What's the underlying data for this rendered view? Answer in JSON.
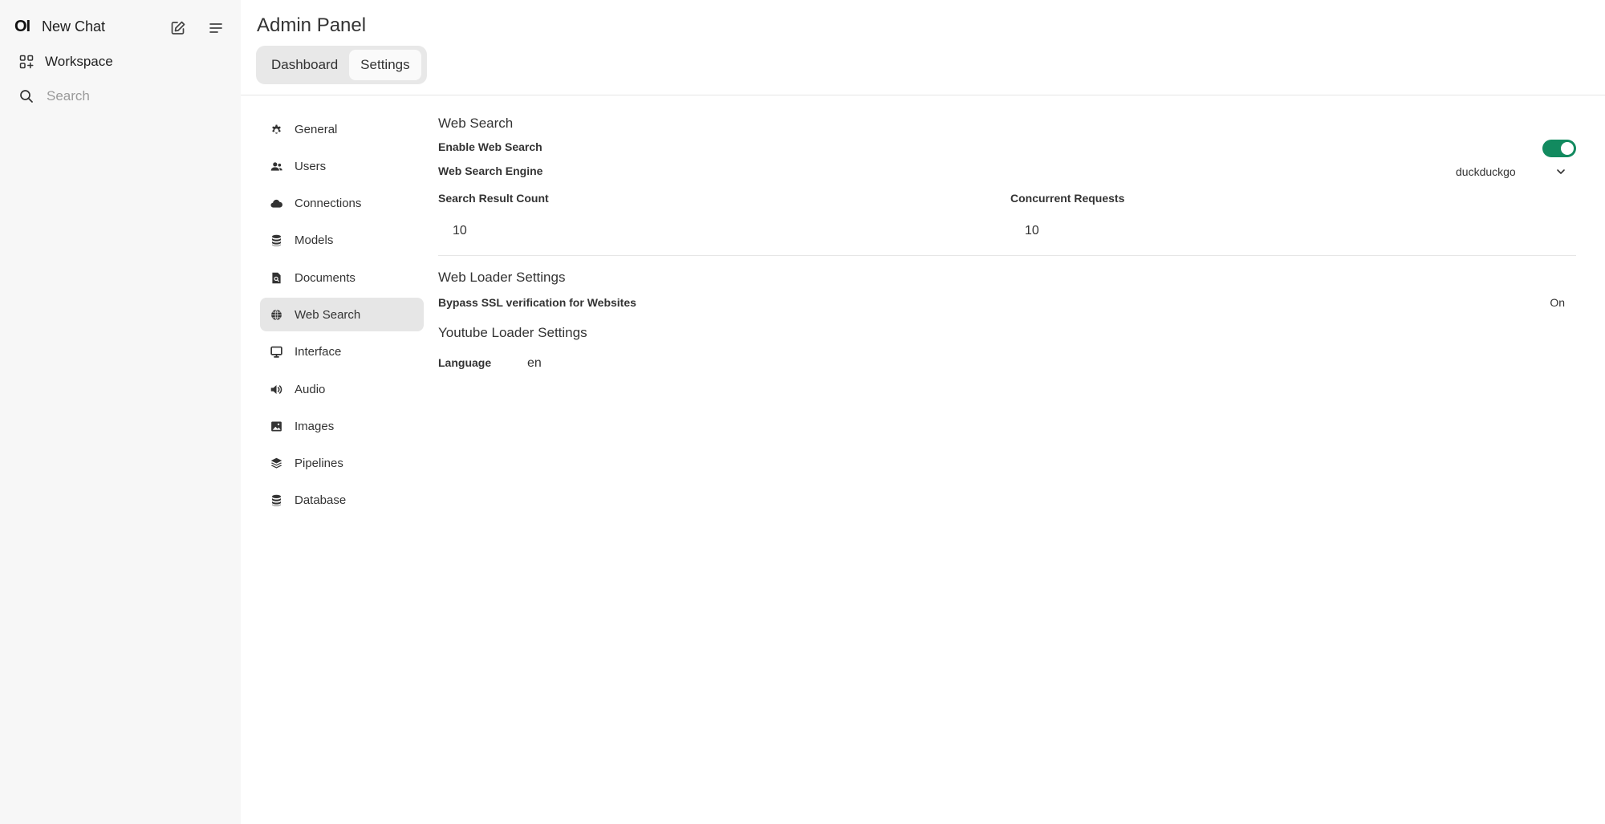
{
  "sidebar": {
    "logo": "OI",
    "new_chat": "New Chat",
    "workspace": "Workspace",
    "search_placeholder": "Search"
  },
  "header": {
    "title": "Admin Panel",
    "tabs": [
      {
        "label": "Dashboard",
        "active": false
      },
      {
        "label": "Settings",
        "active": true
      }
    ]
  },
  "settings_nav": [
    {
      "label": "General",
      "icon": "gear-icon"
    },
    {
      "label": "Users",
      "icon": "users-icon"
    },
    {
      "label": "Connections",
      "icon": "cloud-icon"
    },
    {
      "label": "Models",
      "icon": "database-icon"
    },
    {
      "label": "Documents",
      "icon": "document-search-icon"
    },
    {
      "label": "Web Search",
      "icon": "globe-icon",
      "active": true
    },
    {
      "label": "Interface",
      "icon": "monitor-icon"
    },
    {
      "label": "Audio",
      "icon": "speaker-icon"
    },
    {
      "label": "Images",
      "icon": "image-icon"
    },
    {
      "label": "Pipelines",
      "icon": "layers-icon"
    },
    {
      "label": "Database",
      "icon": "database-icon"
    }
  ],
  "web_search": {
    "heading": "Web Search",
    "enable_label": "Enable Web Search",
    "enabled": true,
    "engine_label": "Web Search Engine",
    "engine_value": "duckduckgo",
    "result_count_label": "Search Result Count",
    "result_count_value": "10",
    "concurrent_label": "Concurrent Requests",
    "concurrent_value": "10"
  },
  "web_loader": {
    "heading": "Web Loader Settings",
    "bypass_ssl_label": "Bypass SSL verification for Websites",
    "bypass_ssl_value": "On"
  },
  "youtube_loader": {
    "heading": "Youtube Loader Settings",
    "language_label": "Language",
    "language_value": "en"
  },
  "colors": {
    "toggle_on": "#128a5f",
    "sidebar_bg": "#f7f7f7",
    "active_nav_bg": "#e6e6e6"
  }
}
